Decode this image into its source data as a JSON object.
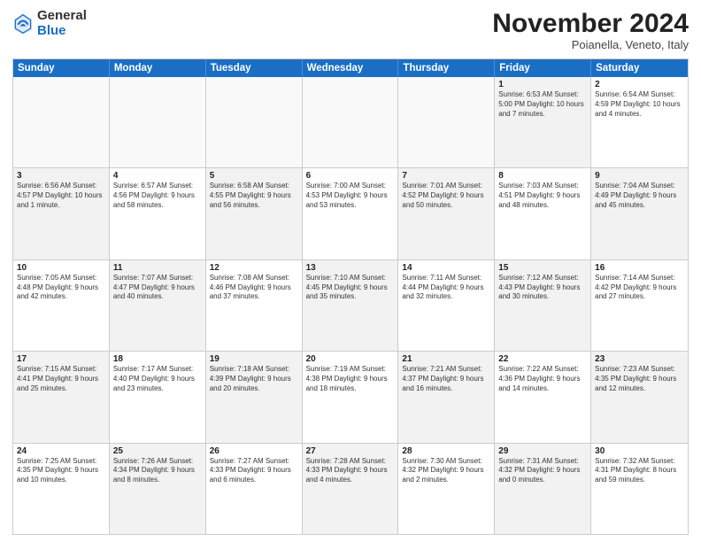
{
  "logo": {
    "general": "General",
    "blue": "Blue"
  },
  "title": "November 2024",
  "location": "Poianella, Veneto, Italy",
  "header_days": [
    "Sunday",
    "Monday",
    "Tuesday",
    "Wednesday",
    "Thursday",
    "Friday",
    "Saturday"
  ],
  "weeks": [
    [
      {
        "day": "",
        "info": "",
        "empty": true
      },
      {
        "day": "",
        "info": "",
        "empty": true
      },
      {
        "day": "",
        "info": "",
        "empty": true
      },
      {
        "day": "",
        "info": "",
        "empty": true
      },
      {
        "day": "",
        "info": "",
        "empty": true
      },
      {
        "day": "1",
        "info": "Sunrise: 6:53 AM\nSunset: 5:00 PM\nDaylight: 10 hours and 7 minutes.",
        "gray": true
      },
      {
        "day": "2",
        "info": "Sunrise: 6:54 AM\nSunset: 4:59 PM\nDaylight: 10 hours and 4 minutes.",
        "gray": false
      }
    ],
    [
      {
        "day": "3",
        "info": "Sunrise: 6:56 AM\nSunset: 4:57 PM\nDaylight: 10 hours and 1 minute.",
        "gray": true
      },
      {
        "day": "4",
        "info": "Sunrise: 6:57 AM\nSunset: 4:56 PM\nDaylight: 9 hours and 58 minutes.",
        "gray": false
      },
      {
        "day": "5",
        "info": "Sunrise: 6:58 AM\nSunset: 4:55 PM\nDaylight: 9 hours and 56 minutes.",
        "gray": true
      },
      {
        "day": "6",
        "info": "Sunrise: 7:00 AM\nSunset: 4:53 PM\nDaylight: 9 hours and 53 minutes.",
        "gray": false
      },
      {
        "day": "7",
        "info": "Sunrise: 7:01 AM\nSunset: 4:52 PM\nDaylight: 9 hours and 50 minutes.",
        "gray": true
      },
      {
        "day": "8",
        "info": "Sunrise: 7:03 AM\nSunset: 4:51 PM\nDaylight: 9 hours and 48 minutes.",
        "gray": false
      },
      {
        "day": "9",
        "info": "Sunrise: 7:04 AM\nSunset: 4:49 PM\nDaylight: 9 hours and 45 minutes.",
        "gray": true
      }
    ],
    [
      {
        "day": "10",
        "info": "Sunrise: 7:05 AM\nSunset: 4:48 PM\nDaylight: 9 hours and 42 minutes.",
        "gray": false
      },
      {
        "day": "11",
        "info": "Sunrise: 7:07 AM\nSunset: 4:47 PM\nDaylight: 9 hours and 40 minutes.",
        "gray": true
      },
      {
        "day": "12",
        "info": "Sunrise: 7:08 AM\nSunset: 4:46 PM\nDaylight: 9 hours and 37 minutes.",
        "gray": false
      },
      {
        "day": "13",
        "info": "Sunrise: 7:10 AM\nSunset: 4:45 PM\nDaylight: 9 hours and 35 minutes.",
        "gray": true
      },
      {
        "day": "14",
        "info": "Sunrise: 7:11 AM\nSunset: 4:44 PM\nDaylight: 9 hours and 32 minutes.",
        "gray": false
      },
      {
        "day": "15",
        "info": "Sunrise: 7:12 AM\nSunset: 4:43 PM\nDaylight: 9 hours and 30 minutes.",
        "gray": true
      },
      {
        "day": "16",
        "info": "Sunrise: 7:14 AM\nSunset: 4:42 PM\nDaylight: 9 hours and 27 minutes.",
        "gray": false
      }
    ],
    [
      {
        "day": "17",
        "info": "Sunrise: 7:15 AM\nSunset: 4:41 PM\nDaylight: 9 hours and 25 minutes.",
        "gray": true
      },
      {
        "day": "18",
        "info": "Sunrise: 7:17 AM\nSunset: 4:40 PM\nDaylight: 9 hours and 23 minutes.",
        "gray": false
      },
      {
        "day": "19",
        "info": "Sunrise: 7:18 AM\nSunset: 4:39 PM\nDaylight: 9 hours and 20 minutes.",
        "gray": true
      },
      {
        "day": "20",
        "info": "Sunrise: 7:19 AM\nSunset: 4:38 PM\nDaylight: 9 hours and 18 minutes.",
        "gray": false
      },
      {
        "day": "21",
        "info": "Sunrise: 7:21 AM\nSunset: 4:37 PM\nDaylight: 9 hours and 16 minutes.",
        "gray": true
      },
      {
        "day": "22",
        "info": "Sunrise: 7:22 AM\nSunset: 4:36 PM\nDaylight: 9 hours and 14 minutes.",
        "gray": false
      },
      {
        "day": "23",
        "info": "Sunrise: 7:23 AM\nSunset: 4:35 PM\nDaylight: 9 hours and 12 minutes.",
        "gray": true
      }
    ],
    [
      {
        "day": "24",
        "info": "Sunrise: 7:25 AM\nSunset: 4:35 PM\nDaylight: 9 hours and 10 minutes.",
        "gray": false
      },
      {
        "day": "25",
        "info": "Sunrise: 7:26 AM\nSunset: 4:34 PM\nDaylight: 9 hours and 8 minutes.",
        "gray": true
      },
      {
        "day": "26",
        "info": "Sunrise: 7:27 AM\nSunset: 4:33 PM\nDaylight: 9 hours and 6 minutes.",
        "gray": false
      },
      {
        "day": "27",
        "info": "Sunrise: 7:28 AM\nSunset: 4:33 PM\nDaylight: 9 hours and 4 minutes.",
        "gray": true
      },
      {
        "day": "28",
        "info": "Sunrise: 7:30 AM\nSunset: 4:32 PM\nDaylight: 9 hours and 2 minutes.",
        "gray": false
      },
      {
        "day": "29",
        "info": "Sunrise: 7:31 AM\nSunset: 4:32 PM\nDaylight: 9 hours and 0 minutes.",
        "gray": true
      },
      {
        "day": "30",
        "info": "Sunrise: 7:32 AM\nSunset: 4:31 PM\nDaylight: 8 hours and 59 minutes.",
        "gray": false
      }
    ]
  ]
}
